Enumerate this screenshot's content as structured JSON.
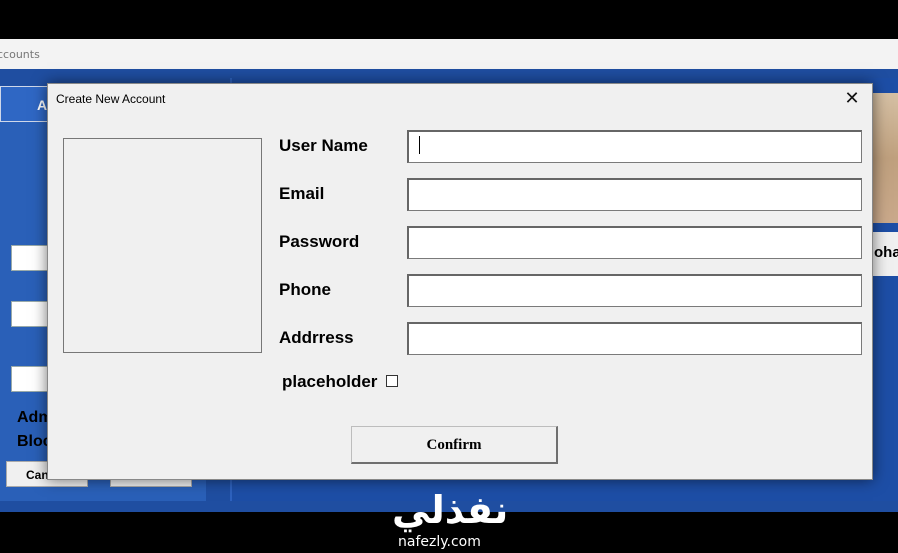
{
  "app": {
    "titlebar_text": "ccounts",
    "top_button_label": "A",
    "admin_label_1": "Adm",
    "admin_label_2": "Bloc",
    "small_button_label": "Can",
    "profile_name_fragment": "oha"
  },
  "dialog": {
    "title": "Create New Account",
    "close_glyph": "✕",
    "fields": [
      {
        "label": "User Name",
        "value": ""
      },
      {
        "label": "Email",
        "value": ""
      },
      {
        "label": "Password",
        "value": ""
      },
      {
        "label": "Phone",
        "value": ""
      },
      {
        "label": "Addrress",
        "value": ""
      }
    ],
    "checkbox_label": "placeholder",
    "checkbox_checked": false,
    "confirm_label": "Confirm"
  },
  "watermark": {
    "arabic": "نفذلي",
    "latin": "nafezly.com"
  }
}
